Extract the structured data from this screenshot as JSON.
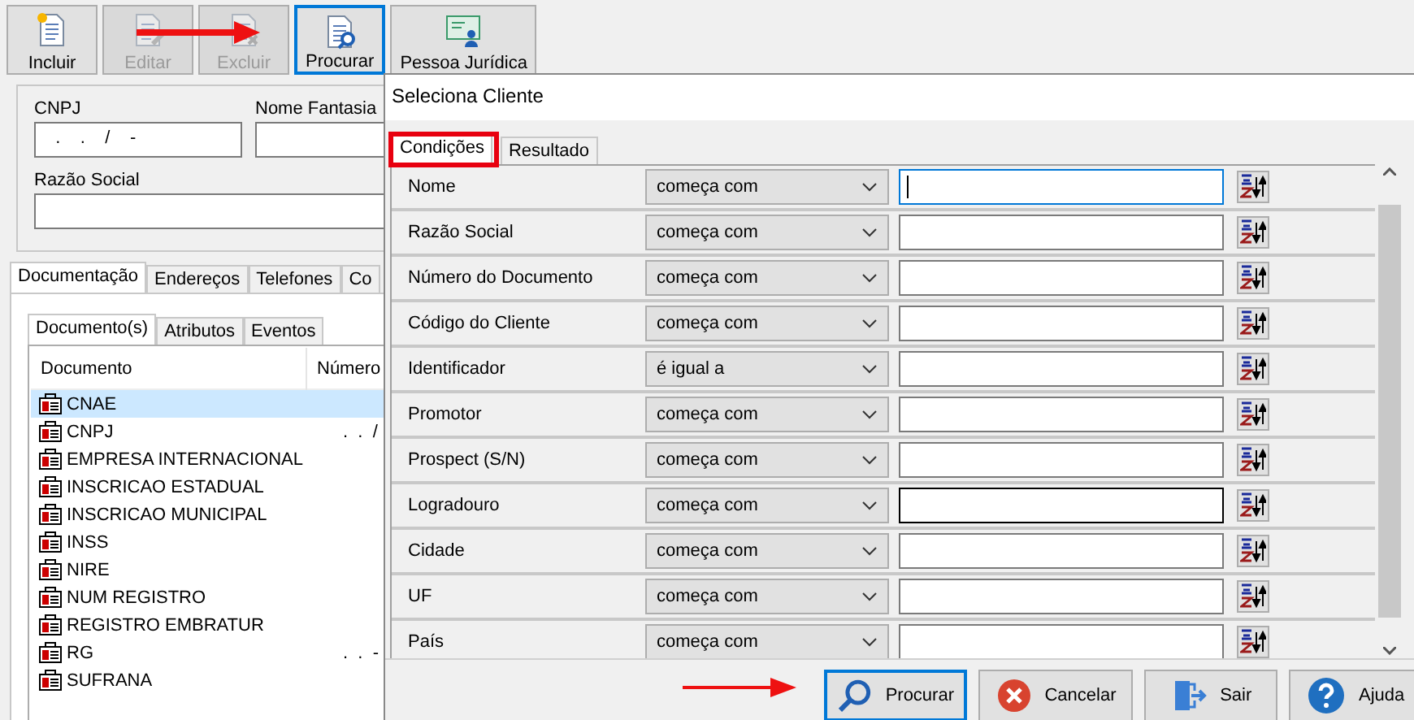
{
  "toolbar": [
    {
      "label": "Incluir",
      "disabled": false,
      "selected": false
    },
    {
      "label": "Editar",
      "disabled": true,
      "selected": false
    },
    {
      "label": "Excluir",
      "disabled": true,
      "selected": false
    },
    {
      "label": "Procurar",
      "disabled": false,
      "selected": true
    },
    {
      "label": "Pessoa Jurídica",
      "disabled": false,
      "selected": false
    }
  ],
  "form": {
    "cnpj": {
      "label": "CNPJ",
      "value": "  .    .    /    -"
    },
    "nome_fantasia": {
      "label": "Nome Fantasia"
    },
    "razao_social": {
      "label": "Razão Social"
    }
  },
  "tabs": [
    {
      "label": "Documentação",
      "selected": true
    },
    {
      "label": "Endereços",
      "selected": false
    },
    {
      "label": "Telefones",
      "selected": false
    },
    {
      "label": "Co",
      "selected": false
    }
  ],
  "subtabs": [
    {
      "label": "Documento(s)",
      "selected": true
    },
    {
      "label": "Atributos",
      "selected": false
    },
    {
      "label": "Eventos",
      "selected": false
    }
  ],
  "documents": {
    "columns": [
      "Documento",
      "Número"
    ],
    "rows": [
      {
        "document": "CNAE",
        "selected": true
      },
      {
        "document": "CNPJ",
        "number": ".  .  /",
        "selected": false
      },
      {
        "document": "EMPRESA INTERNACIONAL",
        "selected": false
      },
      {
        "document": "INSCRICAO ESTADUAL",
        "selected": false
      },
      {
        "document": "INSCRICAO MUNICIPAL",
        "selected": false
      },
      {
        "document": "INSS",
        "selected": false
      },
      {
        "document": "NIRE",
        "selected": false
      },
      {
        "document": "NUM REGISTRO",
        "selected": false
      },
      {
        "document": "REGISTRO EMBRATUR",
        "selected": false
      },
      {
        "document": "RG",
        "number": ".  .  -",
        "selected": false
      },
      {
        "document": "SUFRANA",
        "selected": false
      }
    ]
  },
  "dialog": {
    "title": "Seleciona Cliente",
    "tabs": [
      {
        "label": "Condições",
        "selected": true
      },
      {
        "label": "Resultado",
        "selected": false
      }
    ],
    "conditions": [
      {
        "field": "Nome",
        "operator": "começa com",
        "focused": true,
        "hovered": false
      },
      {
        "field": "Razão Social",
        "operator": "começa com",
        "focused": false,
        "hovered": false
      },
      {
        "field": "Número do Documento",
        "operator": "começa com",
        "focused": false,
        "hovered": false
      },
      {
        "field": "Código do Cliente",
        "operator": "começa com",
        "focused": false,
        "hovered": false
      },
      {
        "field": "Identificador",
        "operator": "é igual a",
        "focused": false,
        "hovered": false
      },
      {
        "field": "Promotor",
        "operator": "começa com",
        "focused": false,
        "hovered": false
      },
      {
        "field": "Prospect (S/N)",
        "operator": "começa com",
        "focused": false,
        "hovered": false
      },
      {
        "field": "Logradouro",
        "operator": "começa com",
        "focused": false,
        "hovered": true
      },
      {
        "field": "Cidade",
        "operator": "começa com",
        "focused": false,
        "hovered": false
      },
      {
        "field": "UF",
        "operator": "começa com",
        "focused": false,
        "hovered": false
      },
      {
        "field": "País",
        "operator": "começa com",
        "focused": false,
        "hovered": false
      }
    ],
    "buttons": [
      {
        "label": "Procurar",
        "kind": "search",
        "selected": true
      },
      {
        "label": "Cancelar",
        "kind": "cancel",
        "selected": false
      },
      {
        "label": "Sair",
        "kind": "exit",
        "selected": false
      },
      {
        "label": "Ajuda",
        "kind": "help",
        "selected": false
      }
    ]
  }
}
